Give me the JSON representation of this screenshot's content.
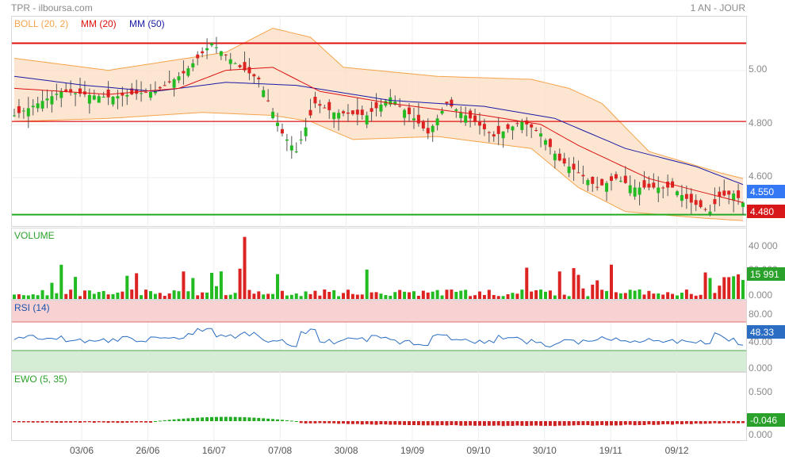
{
  "header": {
    "source": "TPR - ilboursa.com",
    "period": "1 AN - JOUR"
  },
  "legend": [
    {
      "label": "BOLL (20, 2)",
      "color": "#f5a34a"
    },
    {
      "label": "MM (20)",
      "color": "#dd1111"
    },
    {
      "label": "MM (50)",
      "color": "#1a1aa6"
    }
  ],
  "price_axis": {
    "ticks": [
      "5.00",
      "4.800",
      "4.600"
    ],
    "badges": [
      {
        "text": "4.550",
        "color": "#3478f6"
      },
      {
        "text": "4.480",
        "color": "#d81818"
      }
    ]
  },
  "volume_panel": {
    "label": "VOLUME",
    "ticks": [
      "40 000",
      "20 000",
      "0.000"
    ],
    "badge": {
      "text": "15 991",
      "color": "#2aa12a"
    }
  },
  "rsi_panel": {
    "label": "RSI (14)",
    "ticks": [
      "80.00",
      "40.00",
      "0.000"
    ],
    "badge": {
      "text": "48.33",
      "color": "#2a6dc2"
    }
  },
  "ewo_panel": {
    "label": "EWO (5, 35)",
    "ticks": [
      "0.500",
      "0.000"
    ],
    "badge": {
      "text": "-0.046",
      "color": "#2aa12a"
    }
  },
  "x_axis": {
    "labels": [
      "03/06",
      "26/06",
      "16/07",
      "07/08",
      "30/08",
      "19/09",
      "09/10",
      "30/10",
      "19/11",
      "09/12"
    ]
  },
  "chart_data": {
    "type": "candlestick",
    "price": {
      "ylim": [
        4.48,
        5.15
      ],
      "levels": [
        {
          "value": 5.08,
          "color": "#e01010"
        },
        {
          "value": 4.82,
          "color": "#e01010"
        },
        {
          "value": 4.51,
          "color": "#22aa22"
        }
      ],
      "anchors_close": [
        [
          0,
          4.84
        ],
        [
          10,
          4.92
        ],
        [
          20,
          4.9
        ],
        [
          30,
          4.92
        ],
        [
          36,
          4.98
        ],
        [
          42,
          5.08
        ],
        [
          48,
          5.0
        ],
        [
          52,
          4.96
        ],
        [
          57,
          4.78
        ],
        [
          60,
          4.72
        ],
        [
          64,
          4.88
        ],
        [
          68,
          4.85
        ],
        [
          75,
          4.84
        ],
        [
          80,
          4.9
        ],
        [
          85,
          4.83
        ],
        [
          88,
          4.78
        ],
        [
          92,
          4.88
        ],
        [
          97,
          4.83
        ],
        [
          102,
          4.77
        ],
        [
          108,
          4.82
        ],
        [
          112,
          4.78
        ],
        [
          116,
          4.69
        ],
        [
          120,
          4.65
        ],
        [
          124,
          4.6
        ],
        [
          128,
          4.63
        ],
        [
          132,
          4.6
        ],
        [
          136,
          4.6
        ],
        [
          140,
          4.6
        ],
        [
          144,
          4.55
        ],
        [
          148,
          4.52
        ],
        [
          150,
          4.57
        ],
        [
          153,
          4.58
        ],
        [
          155,
          4.55
        ]
      ],
      "bollinger_upper": [
        [
          0,
          5.03
        ],
        [
          20,
          4.99
        ],
        [
          45,
          5.05
        ],
        [
          55,
          5.13
        ],
        [
          63,
          5.1
        ],
        [
          70,
          5.0
        ],
        [
          90,
          4.97
        ],
        [
          110,
          4.96
        ],
        [
          118,
          4.93
        ],
        [
          125,
          4.88
        ],
        [
          135,
          4.72
        ],
        [
          150,
          4.65
        ],
        [
          155,
          4.63
        ]
      ],
      "bollinger_lower": [
        [
          0,
          4.82
        ],
        [
          20,
          4.83
        ],
        [
          40,
          4.85
        ],
        [
          55,
          4.84
        ],
        [
          63,
          4.82
        ],
        [
          72,
          4.76
        ],
        [
          90,
          4.77
        ],
        [
          110,
          4.73
        ],
        [
          120,
          4.6
        ],
        [
          130,
          4.52
        ],
        [
          145,
          4.5
        ],
        [
          155,
          4.49
        ]
      ],
      "ma20": [
        [
          0,
          4.93
        ],
        [
          20,
          4.91
        ],
        [
          35,
          4.93
        ],
        [
          45,
          4.99
        ],
        [
          55,
          5.0
        ],
        [
          65,
          4.92
        ],
        [
          80,
          4.88
        ],
        [
          100,
          4.84
        ],
        [
          112,
          4.81
        ],
        [
          120,
          4.74
        ],
        [
          135,
          4.63
        ],
        [
          155,
          4.55
        ]
      ],
      "ma50": [
        [
          0,
          4.97
        ],
        [
          15,
          4.94
        ],
        [
          30,
          4.92
        ],
        [
          45,
          4.95
        ],
        [
          60,
          4.94
        ],
        [
          80,
          4.89
        ],
        [
          100,
          4.87
        ],
        [
          115,
          4.83
        ],
        [
          130,
          4.73
        ],
        [
          145,
          4.67
        ],
        [
          155,
          4.61
        ]
      ]
    },
    "volume": {
      "ylim": [
        0,
        50000
      ]
    },
    "rsi": {
      "ylim": [
        0,
        100
      ],
      "overbought": 70,
      "oversold": 30
    },
    "ewo": {
      "ylim": [
        -0.2,
        0.6
      ]
    },
    "bars": 156
  }
}
